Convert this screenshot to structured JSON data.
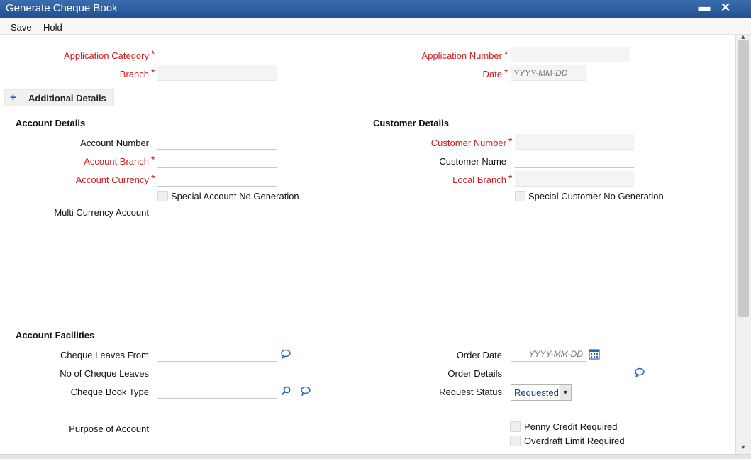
{
  "window": {
    "title": "Generate Cheque Book",
    "minimize_glyph": "▬",
    "close_glyph": "✕"
  },
  "toolbar": {
    "save_label": "Save",
    "hold_label": "Hold"
  },
  "header": {
    "application_category_label": "Application Category",
    "application_category_value": "",
    "branch_label": "Branch",
    "branch_value": "",
    "application_number_label": "Application Number",
    "application_number_value": "",
    "date_label": "Date",
    "date_placeholder": "YYYY-MM-DD"
  },
  "additional_details": {
    "expand_glyph": "+",
    "label": "Additional Details"
  },
  "account_details": {
    "heading": "Account Details",
    "account_number_label": "Account Number",
    "account_branch_label": "Account Branch",
    "account_currency_label": "Account Currency",
    "special_account_label": "Special Account No Generation",
    "multi_currency_label": "Multi Currency Account"
  },
  "customer_details": {
    "heading": "Customer Details",
    "customer_number_label": "Customer Number",
    "customer_name_label": "Customer Name",
    "local_branch_label": "Local Branch",
    "special_customer_label": "Special Customer No Generation"
  },
  "account_facilities": {
    "heading": "Account Facilities",
    "cheque_leaves_from_label": "Cheque Leaves From",
    "no_of_cheque_leaves_label": "No of Cheque Leaves",
    "cheque_book_type_label": "Cheque Book Type",
    "purpose_label": "Purpose of Account",
    "order_date_label": "Order Date",
    "order_date_placeholder": "YYYY-MM-DD",
    "order_details_label": "Order Details",
    "request_status_label": "Request Status",
    "request_status_value": "Requested",
    "penny_credit_label": "Penny Credit Required",
    "overdraft_limit_label": "Overdraft Limit Required"
  },
  "required_marker": "*",
  "colors": {
    "titlebar": "#2c5a9a",
    "required_label": "#cc1b1b",
    "icon_blue": "#2a62b8"
  }
}
